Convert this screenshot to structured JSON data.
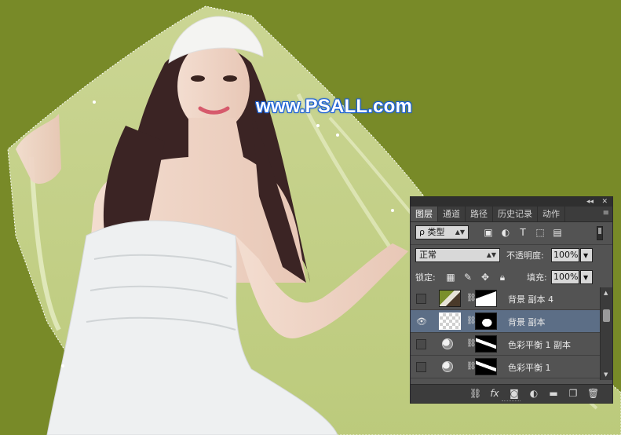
{
  "watermark": "www.PSALL.com",
  "panel": {
    "tabs": [
      {
        "label": "图层",
        "active": true
      },
      {
        "label": "通道",
        "active": false
      },
      {
        "label": "路径",
        "active": false
      },
      {
        "label": "历史记录",
        "active": false
      },
      {
        "label": "动作",
        "active": false
      }
    ],
    "titlebar_collapse": "◂◂",
    "titlebar_close": "✕",
    "menu_icon": "≡",
    "filter": {
      "kind_label": "ρ 类型",
      "icons": [
        "image-filter-icon",
        "adjustment-filter-icon",
        "type-filter-icon",
        "shape-filter-icon",
        "smart-object-filter-icon"
      ]
    },
    "blend_mode": "正常",
    "opacity_label": "不透明度:",
    "opacity_value": "100%",
    "lock_label": "锁定:",
    "fill_label": "填充:",
    "fill_value": "100%",
    "layers": [
      {
        "name": "背景 副本 4",
        "visible": false,
        "selected": false,
        "type": "photo"
      },
      {
        "name": "背景 副本",
        "visible": true,
        "selected": true,
        "type": "photo"
      },
      {
        "name": "色彩平衡 1 副本",
        "visible": false,
        "selected": false,
        "type": "adjustment"
      },
      {
        "name": "色彩平衡 1",
        "visible": false,
        "selected": false,
        "type": "adjustment"
      }
    ],
    "bottom_icons": [
      "link-layers-icon",
      "fx-icon",
      "add-mask-icon",
      "new-adjustment-icon",
      "new-group-icon",
      "new-layer-icon",
      "delete-layer-icon"
    ],
    "fx_label": "fx"
  },
  "colors": {
    "background": "#788a28",
    "panel": "#535353",
    "selected_layer": "#5c6e86"
  }
}
